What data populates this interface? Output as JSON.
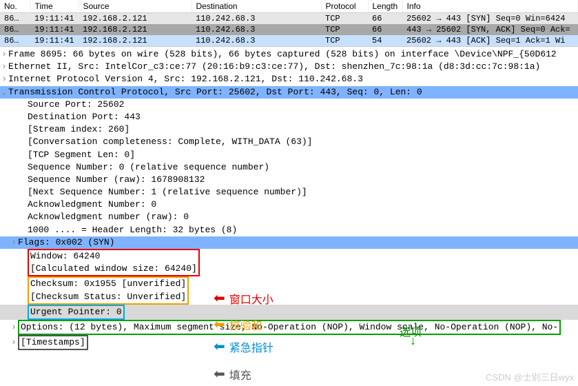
{
  "columns": {
    "no": "No.",
    "time": "Time",
    "source": "Source",
    "destination": "Destination",
    "protocol": "Protocol",
    "length": "Length",
    "info": "Info"
  },
  "packets": [
    {
      "no": "86…",
      "time": "19:11:41",
      "src": "192.168.2.121",
      "dst": "110.242.68.3",
      "proto": "TCP",
      "len": "66",
      "info": "25602 → 443 [SYN] Seq=0 Win=6424"
    },
    {
      "no": "86…",
      "time": "19:11:41",
      "src": "192.168.2.121",
      "dst": "110.242.68.3",
      "proto": "TCP",
      "len": "66",
      "info": "443 → 25602 [SYN, ACK] Seq=0 Ack="
    },
    {
      "no": "86…",
      "time": "19:11:41",
      "src": "192.168.2.121",
      "dst": "110.242.68.3",
      "proto": "TCP",
      "len": "54",
      "info": "25602 → 443 [ACK] Seq=1 Ack=1 Wi"
    }
  ],
  "detail": {
    "frame": "Frame 8695: 66 bytes on wire (528 bits), 66 bytes captured (528 bits) on interface \\Device\\NPF_{50D612",
    "eth": "Ethernet II, Src: IntelCor_c3:ce:77 (20:16:b9:c3:ce:77), Dst: shenzhen_7c:98:1a (d8:3d:cc:7c:98:1a)",
    "ip": "Internet Protocol Version 4, Src: 192.168.2.121, Dst: 110.242.68.3",
    "tcp": "Transmission Control Protocol, Src Port: 25602, Dst Port: 443, Seq: 0, Len: 0",
    "srcport": "Source Port: 25602",
    "dstport": "Destination Port: 443",
    "stream": "[Stream index: 260]",
    "conv": "[Conversation completeness: Complete, WITH_DATA (63)]",
    "seglen": "[TCP Segment Len: 0]",
    "seqrel": "Sequence Number: 0    (relative sequence number)",
    "seqraw": "Sequence Number (raw): 1678908132",
    "nextseq": "[Next Sequence Number: 1    (relative sequence number)]",
    "ack": "Acknowledgment Number: 0",
    "ackraw": "Acknowledgment number (raw): 0",
    "hdrlen": "1000 .... = Header Length: 32 bytes (8)",
    "flags": "Flags: 0x002 (SYN)",
    "window": "Window: 64240",
    "calcwin": "[Calculated window size: 64240]",
    "checksum": "Checksum: 0x1955 [unverified]",
    "chkstatus": "[Checksum Status: Unverified]",
    "urgent": "Urgent Pointer: 0",
    "options": "Options: (12 bytes), Maximum segment size, No-Operation (NOP), Window scale, No-Operation (NOP), No-",
    "timestamps": "[Timestamps]"
  },
  "annotations": {
    "window": "窗口大小",
    "checksum": "校验和",
    "urgent": "紧急指针",
    "options": "选项",
    "fill": "填充"
  },
  "watermark": "CSDN @士别三日wyx"
}
